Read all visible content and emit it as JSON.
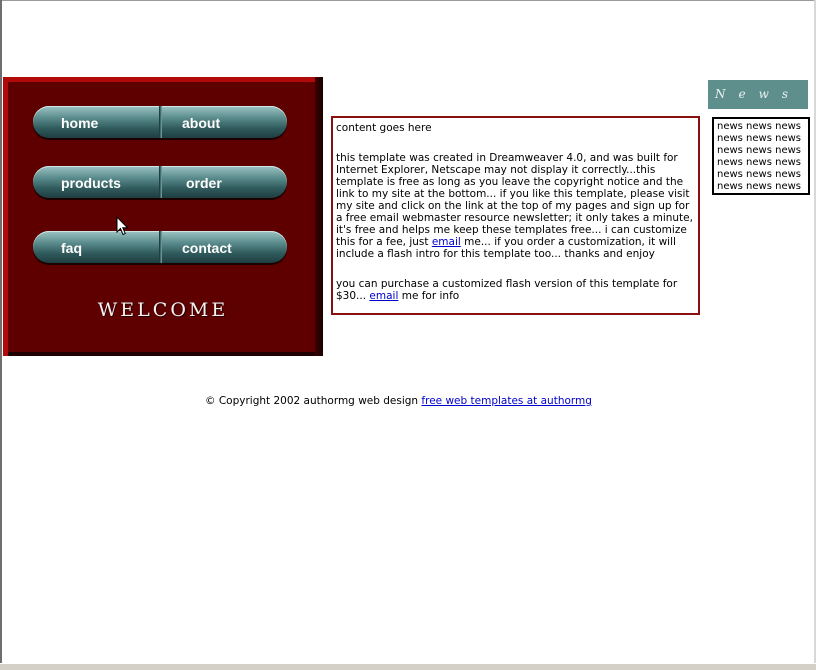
{
  "nav": {
    "home": "home",
    "about": "about",
    "products": "products",
    "order": "order",
    "faq": "faq",
    "contact": "contact"
  },
  "hero": {
    "welcome": "WELCOME"
  },
  "content": {
    "heading": "content goes here",
    "para1_before": "this template was created in Dreamweaver 4.0, and was built for Internet Explorer, Netscape may not display it correctly...this template is free as long as you leave the copyright notice and the link to my site at the bottom... if you like this template, please visit my site and click on the link at the top of my pages and sign up for a free email webmaster resource newsletter; it only takes a minute, it's free and helps me keep these templates free... i can customize this for a fee, just ",
    "para1_link": "email",
    "para1_after": " me... if you order a customization, it will include a flash intro for this template too... thanks and enjoy",
    "para2_before": "you can purchase a customized flash version of this template for $30... ",
    "para2_link": "email",
    "para2_after": " me for info"
  },
  "news": {
    "banner": "News",
    "lines": [
      "news news news",
      "news news news",
      "news news news",
      "news news news",
      "news news news",
      "news news news"
    ]
  },
  "footer": {
    "copyright": "© Copyright 2002 authormg web design ",
    "link": "free web templates at authormg"
  }
}
